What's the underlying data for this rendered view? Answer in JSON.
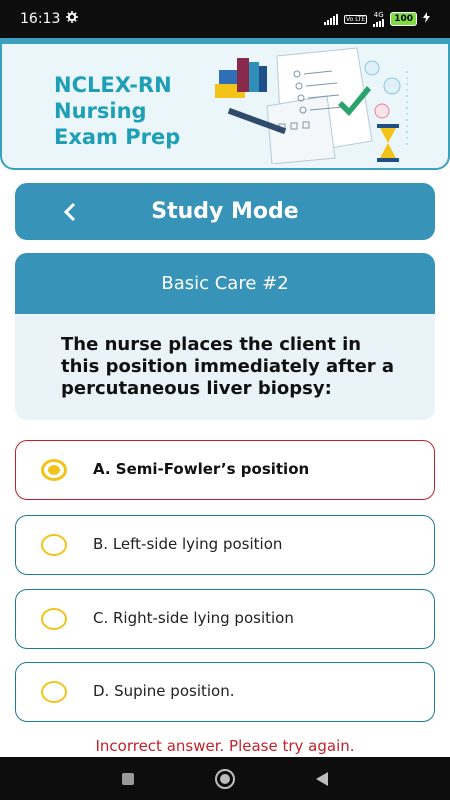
{
  "status_bar": {
    "time": "16:13",
    "lte_label": "Vo LTE",
    "network_label": "4G",
    "battery": "100"
  },
  "header": {
    "app_title": "NCLEX-RN\nNursing\nExam Prep"
  },
  "mode_bar": {
    "title": "Study Mode",
    "back_icon": "chevron-left-icon"
  },
  "question": {
    "category": "Basic Care #2",
    "text": "The nurse places the client in this position immediately after a percutaneous liver biopsy:"
  },
  "options": [
    {
      "label": "A. Semi-Fowler’s position",
      "selected": true,
      "state": "incorrect"
    },
    {
      "label": "B. Left-side lying position",
      "selected": false,
      "state": "normal"
    },
    {
      "label": "C. Right-side lying position",
      "selected": false,
      "state": "normal"
    },
    {
      "label": "D. Supine position.",
      "selected": false,
      "state": "normal"
    }
  ],
  "feedback": "Incorrect answer. Please try again.",
  "colors": {
    "primary": "#3793b8",
    "title_teal": "#1e9fb5",
    "error": "#c2222a",
    "radio": "#f2c318"
  }
}
